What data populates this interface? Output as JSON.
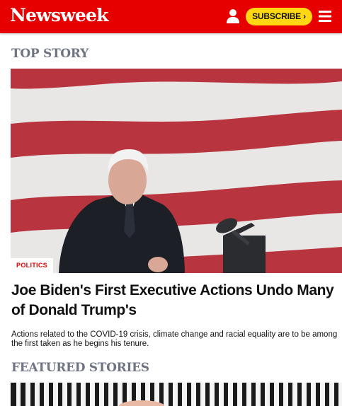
{
  "header": {
    "logo": "Newsweek",
    "subscribe_label": "SUBSCRIBE ›",
    "icons": [
      "user-icon",
      "menu-icon"
    ],
    "colors": {
      "brand": "#e60000",
      "subscribe": "#ffd813"
    }
  },
  "top_story": {
    "section_title": "TOP STORY",
    "category": "POLITICS",
    "headline": "Joe Biden's First Executive Actions Undo Many of Donald Trump's",
    "summary": "Actions related to the COVID-19 crisis, climate change and racial equality are to be among the first taken as he begins his tenure."
  },
  "featured": {
    "section_title": "FEATURED STORIES"
  }
}
